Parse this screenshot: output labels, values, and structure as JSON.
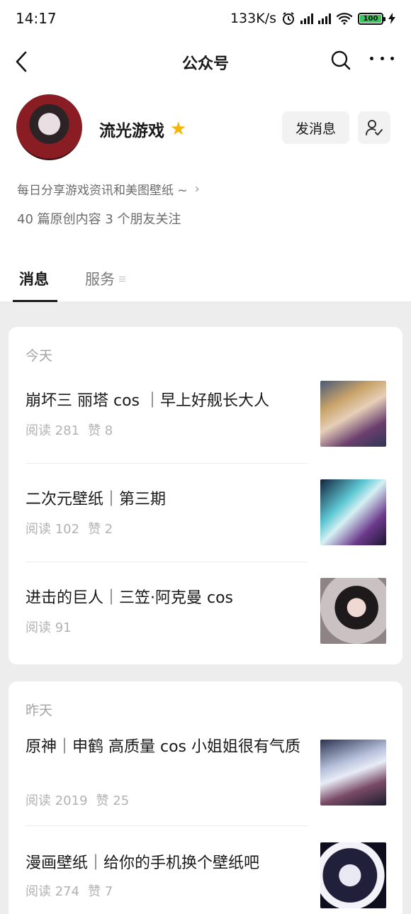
{
  "status_bar": {
    "time": "14:17",
    "network_speed": "133K/s",
    "battery": "100"
  },
  "nav": {
    "title": "公众号",
    "back_icon": "chevron-left-icon",
    "search_icon": "search-icon",
    "more_icon": "more-dots-icon"
  },
  "profile": {
    "name": "流光游戏",
    "badge_icon": "star-icon",
    "send_label": "发消息",
    "follow_icon": "user-check-icon",
    "description": "每日分享游戏资讯和美图壁纸 ~",
    "stats": "40 篇原创内容  3 个朋友关注"
  },
  "tabs": [
    {
      "label": "消息",
      "active": true
    },
    {
      "label": "服务",
      "active": false
    }
  ],
  "groups": [
    {
      "day": "今天",
      "articles": [
        {
          "title": "崩坏三 丽塔 cos ｜早上好舰长大人",
          "reads": "阅读 281",
          "likes": "赞 8"
        },
        {
          "title": "二次元壁纸｜第三期",
          "reads": "阅读 102",
          "likes": "赞 2"
        },
        {
          "title": "进击的巨人｜三笠·阿克曼 cos",
          "reads": "阅读 91",
          "likes": ""
        }
      ]
    },
    {
      "day": "昨天",
      "articles": [
        {
          "title": "原神｜申鹤 高质量 cos 小姐姐很有气质",
          "reads": "阅读 2019",
          "likes": "赞 25"
        },
        {
          "title": "漫画壁纸｜给你的手机换个壁纸吧",
          "reads": "阅读 274",
          "likes": "赞 7"
        }
      ]
    }
  ]
}
